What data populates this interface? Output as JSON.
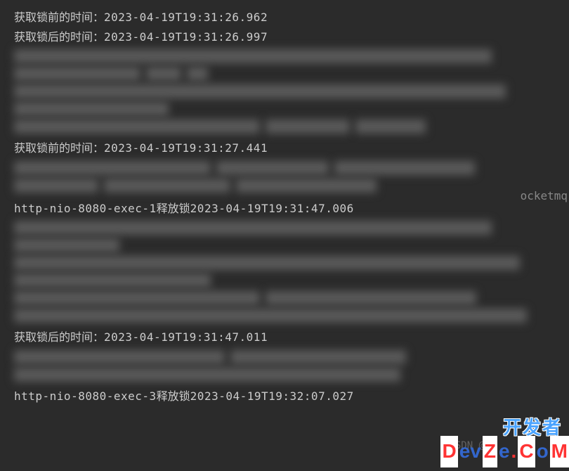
{
  "logs": {
    "line1_label": "获取锁前的时间：",
    "line1_time": "2023-04-19T19:31:26.962",
    "line2_label": "获取锁后的时间：",
    "line2_time": "2023-04-19T19:31:26.997",
    "line3_label": "获取锁前的时间：",
    "line3_time": "2023-04-19T19:31:27.441",
    "line4_prefix": "http-nio-8080-exec-1",
    "line4_label": "释放锁",
    "line4_time": "2023-04-19T19:31:47.006",
    "line5_label": "获取锁后的时间：",
    "line5_time": "2023-04-19T19:31:47.011",
    "line6_prefix": "http-nio-8080-exec-3",
    "line6_label": "释放锁",
    "line6_time": "2023-04-19T19:32:07.027",
    "fragment_text": "ocketmq"
  },
  "watermark": {
    "cn": "开发者",
    "en_part1": "D",
    "en_part2": "ev",
    "en_part3": "Z",
    "en_part4": "e",
    "en_part5": ".",
    "en_part6": "C",
    "en_part7": "o",
    "en_part8": "M",
    "csdn": "CSDN @"
  },
  "colors": {
    "bg": "#2b2b2b",
    "text": "#bbbbbb",
    "watermark_blue": "#4aa3ff",
    "watermark_red": "#ff3333"
  }
}
